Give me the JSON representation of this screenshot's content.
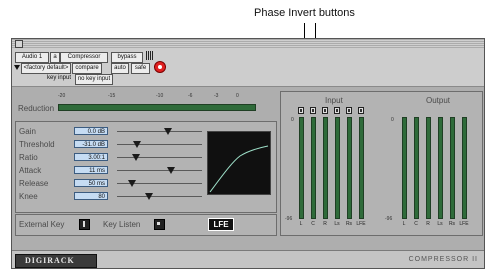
{
  "callouts": {
    "phase_invert": "Phase Invert buttons"
  },
  "header": {
    "track": "Audio 1",
    "insert_letter": "a",
    "plugin_name": "Compressor",
    "bypass": "bypass",
    "preset": "<factory default>",
    "compare": "compare",
    "auto": "auto",
    "safe": "safe",
    "key_input_label": "key input",
    "key_input_value": "no key input"
  },
  "reduction": {
    "label": "Reduction",
    "ticks": [
      "-20",
      "-15",
      "-10",
      "-6",
      "-3",
      "0"
    ]
  },
  "params": [
    {
      "label": "Gain",
      "value": "0.0 dB",
      "level": 0.6
    },
    {
      "label": "Threshold",
      "value": "-31.0 dB",
      "level": 0.23
    },
    {
      "label": "Ratio",
      "value": "3.00:1",
      "level": 0.22
    },
    {
      "label": "Attack",
      "value": "11 ms",
      "level": 0.64
    },
    {
      "label": "Release",
      "value": "50 ms",
      "level": 0.18
    },
    {
      "label": "Knee",
      "value": "80",
      "level": 0.38
    }
  ],
  "external_key": "External Key",
  "key_listen": "Key Listen",
  "lfe": "LFE",
  "meters": {
    "input_label": "Input",
    "output_label": "Output",
    "top": "0",
    "bottom": "-96",
    "channels": [
      "L",
      "C",
      "R",
      "Ls",
      "Rs",
      "LFE"
    ]
  },
  "footer": {
    "brand": "DIGIRACK",
    "plugin": "COMPRESSOR II"
  },
  "colors": {
    "meter_green": "#2f6b3a",
    "value_blue": "#c6dcf3",
    "curve": "#9ee0c9"
  }
}
